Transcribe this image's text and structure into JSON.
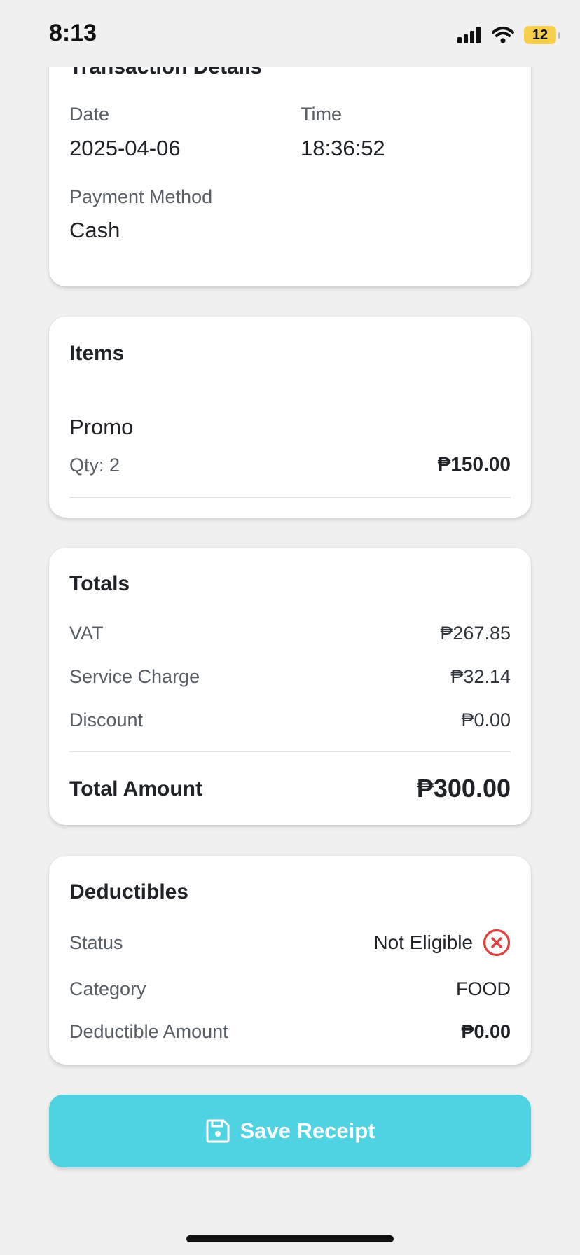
{
  "status_bar": {
    "time": "8:13",
    "battery": "12"
  },
  "transaction": {
    "title": "Transaction Details",
    "date_label": "Date",
    "date": "2025-04-06",
    "time_label": "Time",
    "time": "18:36:52",
    "payment_label": "Payment Method",
    "payment": "Cash"
  },
  "items": {
    "title": "Items",
    "list": [
      {
        "name": "Promo",
        "qty": "Qty: 2",
        "price": "₱150.00"
      }
    ]
  },
  "totals": {
    "title": "Totals",
    "vat_label": "VAT",
    "vat": "₱267.85",
    "service_label": "Service Charge",
    "service": "₱32.14",
    "discount_label": "Discount",
    "discount": "₱0.00",
    "total_label": "Total Amount",
    "total": "₱300.00"
  },
  "deductibles": {
    "title": "Deductibles",
    "status_label": "Status",
    "status": "Not Eligible",
    "category_label": "Category",
    "category": "FOOD",
    "amount_label": "Deductible Amount",
    "amount": "₱0.00"
  },
  "actions": {
    "save_label": "Save Receipt"
  },
  "colors": {
    "accent": "#4fd3e3",
    "error": "#e0403e",
    "background": "#f0f0f0"
  },
  "icons": {
    "status_error": "x-circle-icon",
    "save": "floppy-disk-icon"
  }
}
